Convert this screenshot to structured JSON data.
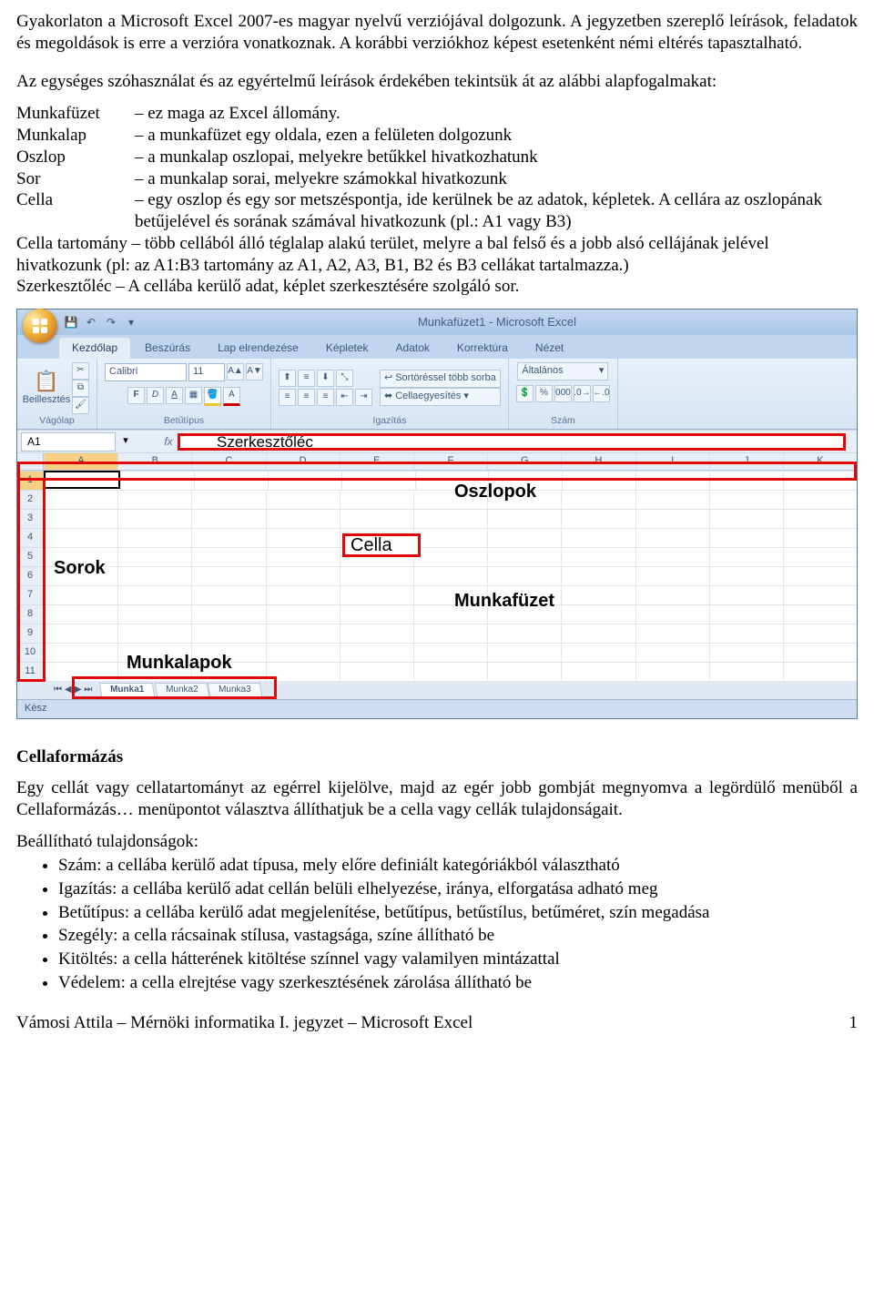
{
  "intro": {
    "p1": "Gyakorlaton a Microsoft Excel 2007-es magyar nyelvű verziójával dolgozunk. A jegyzetben szereplő leírások, feladatok és megoldások is erre a verzióra vonatkoznak. A korábbi verziókhoz képest esetenként némi eltérés tapasztalható.",
    "p2": "Az egységes szóhasználat és az egyértelmű leírások érdekében tekintsük át az alábbi alapfogalmakat:"
  },
  "defs": [
    {
      "term": "Munkafüzet",
      "desc": "– ez maga az Excel állomány."
    },
    {
      "term": "Munkalap",
      "desc": "– a munkafüzet egy oldala, ezen a felületen dolgozunk"
    },
    {
      "term": "Oszlop",
      "desc": "– a munkalap oszlopai, melyekre betűkkel hivatkozhatunk"
    },
    {
      "term": "Sor",
      "desc": "– a munkalap sorai, melyekre számokkal hivatkozunk"
    },
    {
      "term": "Cella",
      "desc": "– egy oszlop és egy sor metszéspontja, ide kerülnek be az adatok, képletek. A cellára az oszlopának betűjelével és sorának számával hivatkozunk (pl.: A1 vagy B3)"
    }
  ],
  "defs_long": "Cella tartomány – több cellából álló téglalap alakú terület, melyre a bal felső és a jobb alsó cellájának jelével hivatkozunk (pl: az A1:B3 tartomány az A1, A2, A3, B1, B2 és B3 cellákat tartalmazza.)",
  "defs_last": "Szerkesztőléc – A cellába kerülő adat, képlet szerkesztésére szolgáló sor.",
  "excel": {
    "title": "Munkafüzet1 - Microsoft Excel",
    "tabs": [
      "Kezdőlap",
      "Beszúrás",
      "Lap elrendezése",
      "Képletek",
      "Adatok",
      "Korrektúra",
      "Nézet"
    ],
    "paste": "Beillesztés",
    "clipboard": "Vágólap",
    "font": {
      "name": "Calibri",
      "size": "11",
      "label": "Betűtípus"
    },
    "align_label": "Igazítás",
    "wrap": "Sortöréssel több sorba",
    "merge": "Cellaegyesítés",
    "number_fmt": "Általános",
    "number_label": "Szám",
    "name_box": "A1",
    "formula_label": "Szerkesztőléc",
    "cols": [
      "A",
      "B",
      "C",
      "D",
      "E",
      "F",
      "G",
      "H",
      "I",
      "J",
      "K"
    ],
    "rows": [
      "1",
      "2",
      "3",
      "4",
      "5",
      "6",
      "7",
      "8",
      "9",
      "10",
      "11"
    ],
    "sheets": [
      "Munka1",
      "Munka2",
      "Munka3"
    ],
    "status": "Kész",
    "ov_oszlopok": "Oszlopok",
    "ov_cella": "Cella",
    "ov_sorok": "Sorok",
    "ov_munkafuzet": "Munkafüzet",
    "ov_munkalapok": "Munkalapok"
  },
  "fmt": {
    "head": "Cellaformázás",
    "p": "Egy cellát vagy cellatartományt az egérrel kijelölve, majd az egér jobb gombját megnyomva a legördülő menüből a Cellaformázás… menüpontot választva állíthatjuk be a cella vagy cellák tulajdonságait.",
    "lead": "Beállítható tulajdonságok:",
    "items": [
      "Szám:  a cellába kerülő adat típusa, mely előre definiált kategóriákból választható",
      "Igazítás: a cellába kerülő adat cellán belüli elhelyezése, iránya, elforgatása adható meg",
      "Betűtípus: a cellába kerülő adat megjelenítése, betűtípus, betűstílus, betűméret, szín megadása",
      "Szegély: a cella rácsainak stílusa, vastagsága, színe állítható be",
      "Kitöltés: a cella hátterének kitöltése színnel vagy valamilyen mintázattal",
      "Védelem: a cella elrejtése vagy szerkesztésének zárolása állítható be"
    ]
  },
  "footer": {
    "left": "Vámosi Attila – Mérnöki informatika I. jegyzet – Microsoft Excel",
    "right": "1"
  }
}
